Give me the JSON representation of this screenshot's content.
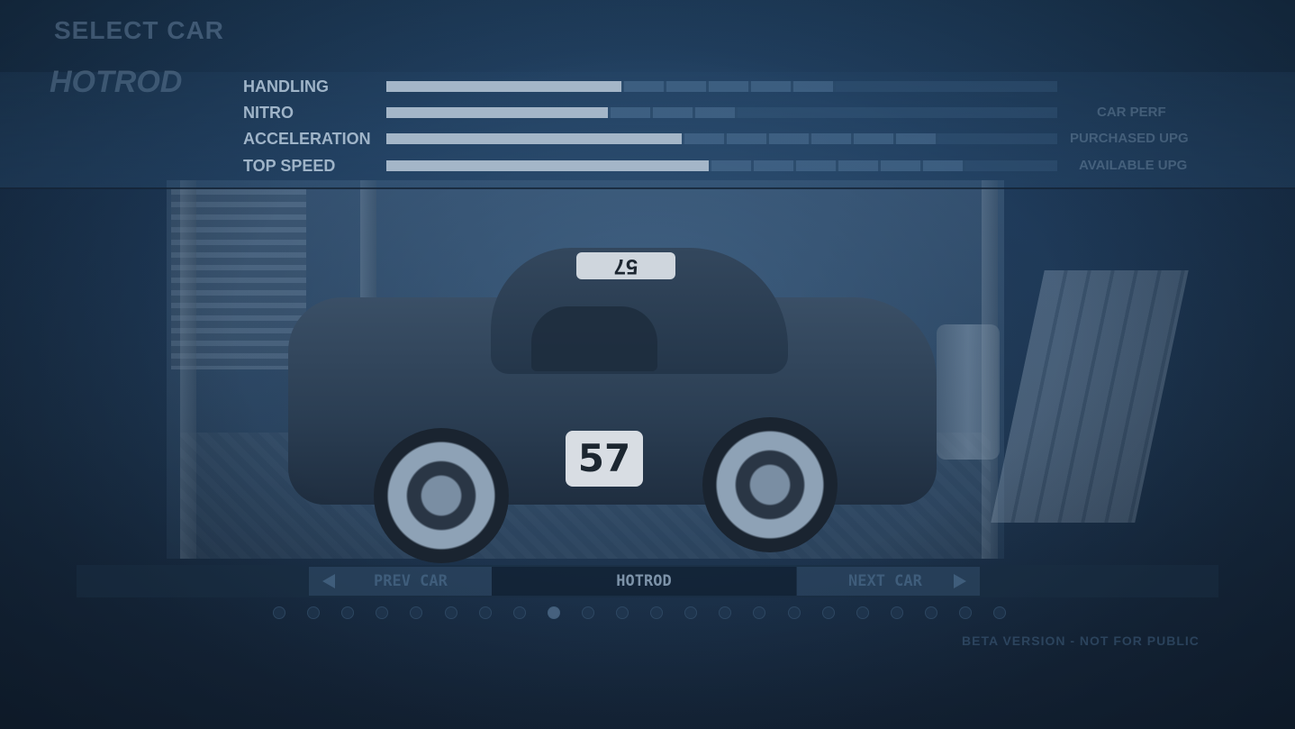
{
  "screen": {
    "title": "SELECT CAR",
    "car_name_header": "HOTROD"
  },
  "stats": [
    {
      "label": "HANDLING",
      "value": 0.35,
      "upgrades": 5
    },
    {
      "label": "NITRO",
      "value": 0.33,
      "upgrades": 3
    },
    {
      "label": "ACCELERATION",
      "value": 0.44,
      "upgrades": 6
    },
    {
      "label": "TOP SPEED",
      "value": 0.48,
      "upgrades": 6
    }
  ],
  "side_info": {
    "car_perf": "CAR PERF",
    "purchased": "PURCHASED UPG",
    "available": "AVAILABLE UPG"
  },
  "car": {
    "roof_number": "57",
    "side_number": "57"
  },
  "nav": {
    "prev_label": "PREV CAR",
    "current_label": "HOTROD",
    "next_label": "NEXT CAR"
  },
  "selector": {
    "count": 22,
    "active_index": 8
  },
  "footer": {
    "beta_text": "BETA VERSION - NOT FOR PUBLIC"
  },
  "colors": {
    "background": "#16263a",
    "bar_fill": "#a4b6c8",
    "label": "#9fb4c8"
  }
}
